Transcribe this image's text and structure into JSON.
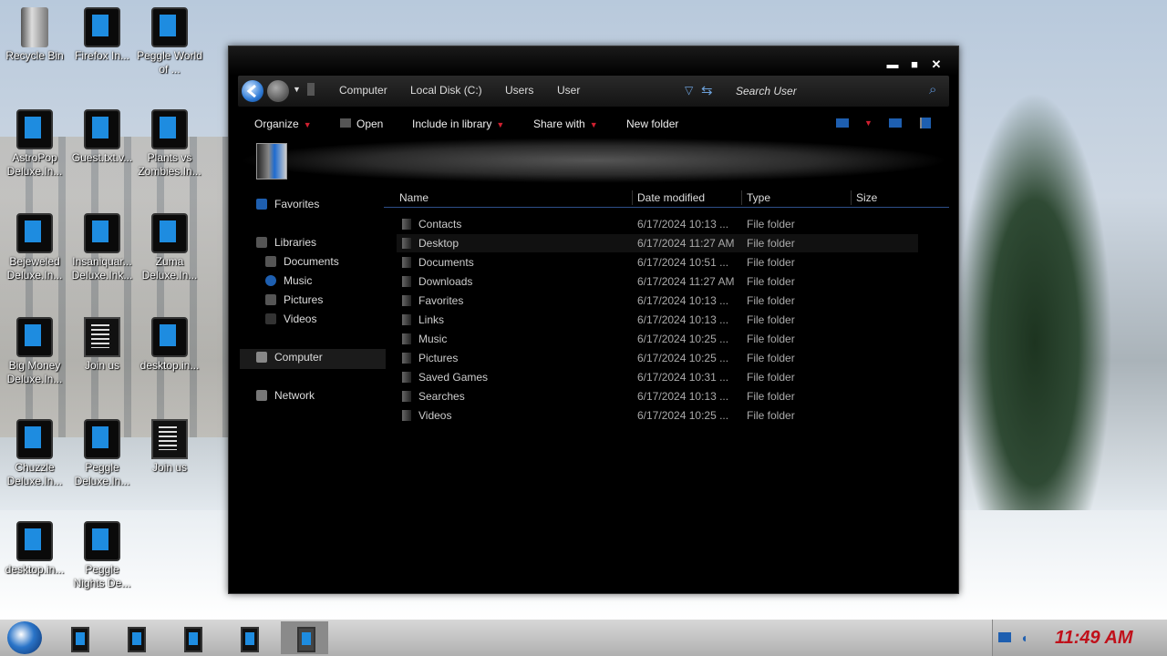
{
  "desktop": {
    "icons": [
      {
        "label": "Recycle Bin",
        "kind": "bin"
      },
      {
        "label": "Firefox In...",
        "kind": "app"
      },
      {
        "label": "Peggle World of ...",
        "kind": "app"
      },
      {
        "label": "AstroPop Deluxe.In...",
        "kind": "app"
      },
      {
        "label": "Guest.txt.v...",
        "kind": "app"
      },
      {
        "label": "Plants vs Zombies.In...",
        "kind": "app"
      },
      {
        "label": "Bejeweled Deluxe.In...",
        "kind": "app"
      },
      {
        "label": "Insaniquar... Deluxe.Ink...",
        "kind": "app"
      },
      {
        "label": "Zuma Deluxe.In...",
        "kind": "app"
      },
      {
        "label": "Big Money Deluxe.In...",
        "kind": "app"
      },
      {
        "label": "Join us",
        "kind": "txt"
      },
      {
        "label": "desktop.in...",
        "kind": "app"
      },
      {
        "label": "Chuzzle Deluxe.In...",
        "kind": "app"
      },
      {
        "label": "Peggle Deluxe.In...",
        "kind": "app"
      },
      {
        "label": "Join us",
        "kind": "txt"
      },
      {
        "label": "desktop.in...",
        "kind": "app"
      },
      {
        "label": "Peggle Nights De...",
        "kind": "app"
      }
    ]
  },
  "window": {
    "controls": {
      "minimize": "▬",
      "maximize": "■",
      "close": "✕"
    },
    "breadcrumb": [
      "Computer",
      "Local Disk (C:)",
      "Users",
      "User"
    ],
    "search_placeholder": "Search User",
    "toolbar": {
      "organize": "Organize",
      "open": "Open",
      "include": "Include in library",
      "share": "Share with",
      "new_folder": "New folder"
    },
    "nav": {
      "favorites": "Favorites",
      "libraries": "Libraries",
      "lib_items": [
        "Documents",
        "Music",
        "Pictures",
        "Videos"
      ],
      "computer": "Computer",
      "network": "Network"
    },
    "columns": {
      "name": "Name",
      "date": "Date modified",
      "type": "Type",
      "size": "Size"
    },
    "files": [
      {
        "name": "Contacts",
        "date": "6/17/2024 10:13 ...",
        "type": "File folder"
      },
      {
        "name": "Desktop",
        "date": "6/17/2024 11:27 AM",
        "type": "File folder"
      },
      {
        "name": "Documents",
        "date": "6/17/2024 10:51 ...",
        "type": "File folder"
      },
      {
        "name": "Downloads",
        "date": "6/17/2024 11:27 AM",
        "type": "File folder"
      },
      {
        "name": "Favorites",
        "date": "6/17/2024 10:13 ...",
        "type": "File folder"
      },
      {
        "name": "Links",
        "date": "6/17/2024 10:13 ...",
        "type": "File folder"
      },
      {
        "name": "Music",
        "date": "6/17/2024 10:25 ...",
        "type": "File folder"
      },
      {
        "name": "Pictures",
        "date": "6/17/2024 10:25 ...",
        "type": "File folder"
      },
      {
        "name": "Saved Games",
        "date": "6/17/2024 10:31 ...",
        "type": "File folder"
      },
      {
        "name": "Searches",
        "date": "6/17/2024 10:13 ...",
        "type": "File folder"
      },
      {
        "name": "Videos",
        "date": "6/17/2024 10:25 ...",
        "type": "File folder"
      }
    ]
  },
  "taskbar": {
    "clock": "11:49 AM"
  },
  "colors": {
    "clock": "#c0101a",
    "accent": "#1e8ce0",
    "caret": "#d02030"
  }
}
